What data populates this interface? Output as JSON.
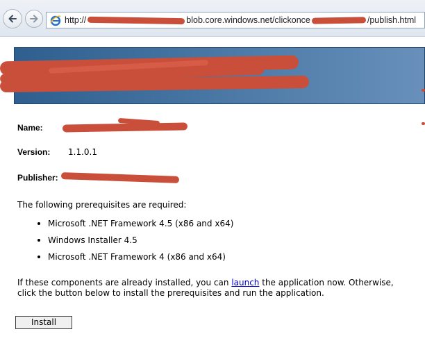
{
  "browser": {
    "url_prefix": "http://",
    "url_middle": "blob.core.windows.net/clickonce",
    "url_suffix": "/publish.html"
  },
  "app_info": {
    "name_label": "Name:",
    "version_label": "Version:",
    "version_value": "1.1.0.1",
    "publisher_label": "Publisher:"
  },
  "prerequisites": {
    "intro": "The following prerequisites are required:",
    "items": [
      "Microsoft .NET Framework 4.5 (x86 and x64)",
      "Windows Installer 4.5",
      "Microsoft .NET Framework 4 (x86 and x64)"
    ]
  },
  "instructions": {
    "line1_before": "If these components are already installed, you can ",
    "link_text": "launch",
    "line1_after": " the application now. Otherwise,",
    "line2": "click the button below to install the prerequisites and run the application."
  },
  "install_button_label": "Install"
}
